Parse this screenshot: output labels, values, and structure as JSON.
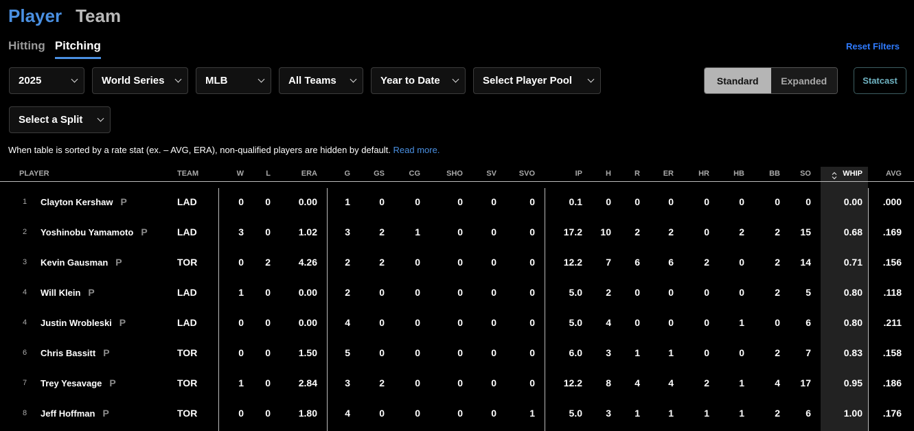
{
  "header": {
    "tabs": [
      "Player",
      "Team"
    ],
    "sub_tabs": [
      "Hitting",
      "Pitching"
    ],
    "reset_label": "Reset Filters"
  },
  "filters": {
    "season": "2025",
    "game_type": "World Series",
    "league": "MLB",
    "team": "All Teams",
    "period": "Year to Date",
    "player_pool": "Select Player Pool",
    "split": "Select a Split"
  },
  "view_toggle": {
    "standard": "Standard",
    "expanded": "Expanded"
  },
  "statcast_label": "Statcast",
  "note": {
    "text": "When table is sorted by a rate stat (ex. – AVG, ERA), non-qualified players are hidden by default.",
    "link": "Read more."
  },
  "table": {
    "columns": [
      "PLAYER",
      "TEAM",
      "W",
      "L",
      "ERA",
      "G",
      "GS",
      "CG",
      "SHO",
      "SV",
      "SVO",
      "IP",
      "H",
      "R",
      "ER",
      "HR",
      "HB",
      "BB",
      "SO",
      "WHIP",
      "AVG"
    ],
    "rows": [
      {
        "rank": "1",
        "name": "Clayton Kershaw",
        "pos": "P",
        "team": "LAD",
        "w": "0",
        "l": "0",
        "era": "0.00",
        "g": "1",
        "gs": "0",
        "cg": "0",
        "sho": "0",
        "sv": "0",
        "svo": "0",
        "ip": "0.1",
        "h": "0",
        "r": "0",
        "er": "0",
        "hr": "0",
        "hb": "0",
        "bb": "0",
        "so": "0",
        "whip": "0.00",
        "avg": ".000"
      },
      {
        "rank": "2",
        "name": "Yoshinobu Yamamoto",
        "pos": "P",
        "team": "LAD",
        "w": "3",
        "l": "0",
        "era": "1.02",
        "g": "3",
        "gs": "2",
        "cg": "1",
        "sho": "0",
        "sv": "0",
        "svo": "0",
        "ip": "17.2",
        "h": "10",
        "r": "2",
        "er": "2",
        "hr": "0",
        "hb": "2",
        "bb": "2",
        "so": "15",
        "whip": "0.68",
        "avg": ".169"
      },
      {
        "rank": "3",
        "name": "Kevin Gausman",
        "pos": "P",
        "team": "TOR",
        "w": "0",
        "l": "2",
        "era": "4.26",
        "g": "2",
        "gs": "2",
        "cg": "0",
        "sho": "0",
        "sv": "0",
        "svo": "0",
        "ip": "12.2",
        "h": "7",
        "r": "6",
        "er": "6",
        "hr": "2",
        "hb": "0",
        "bb": "2",
        "so": "14",
        "whip": "0.71",
        "avg": ".156"
      },
      {
        "rank": "4",
        "name": "Will Klein",
        "pos": "P",
        "team": "LAD",
        "w": "1",
        "l": "0",
        "era": "0.00",
        "g": "2",
        "gs": "0",
        "cg": "0",
        "sho": "0",
        "sv": "0",
        "svo": "0",
        "ip": "5.0",
        "h": "2",
        "r": "0",
        "er": "0",
        "hr": "0",
        "hb": "0",
        "bb": "2",
        "so": "5",
        "whip": "0.80",
        "avg": ".118"
      },
      {
        "rank": "4",
        "name": "Justin Wrobleski",
        "pos": "P",
        "team": "LAD",
        "w": "0",
        "l": "0",
        "era": "0.00",
        "g": "4",
        "gs": "0",
        "cg": "0",
        "sho": "0",
        "sv": "0",
        "svo": "0",
        "ip": "5.0",
        "h": "4",
        "r": "0",
        "er": "0",
        "hr": "0",
        "hb": "1",
        "bb": "0",
        "so": "6",
        "whip": "0.80",
        "avg": ".211"
      },
      {
        "rank": "6",
        "name": "Chris Bassitt",
        "pos": "P",
        "team": "TOR",
        "w": "0",
        "l": "0",
        "era": "1.50",
        "g": "5",
        "gs": "0",
        "cg": "0",
        "sho": "0",
        "sv": "0",
        "svo": "0",
        "ip": "6.0",
        "h": "3",
        "r": "1",
        "er": "1",
        "hr": "0",
        "hb": "0",
        "bb": "2",
        "so": "7",
        "whip": "0.83",
        "avg": ".158"
      },
      {
        "rank": "7",
        "name": "Trey Yesavage",
        "pos": "P",
        "team": "TOR",
        "w": "1",
        "l": "0",
        "era": "2.84",
        "g": "3",
        "gs": "2",
        "cg": "0",
        "sho": "0",
        "sv": "0",
        "svo": "0",
        "ip": "12.2",
        "h": "8",
        "r": "4",
        "er": "4",
        "hr": "2",
        "hb": "1",
        "bb": "4",
        "so": "17",
        "whip": "0.95",
        "avg": ".186"
      },
      {
        "rank": "8",
        "name": "Jeff Hoffman",
        "pos": "P",
        "team": "TOR",
        "w": "0",
        "l": "0",
        "era": "1.80",
        "g": "4",
        "gs": "0",
        "cg": "0",
        "sho": "0",
        "sv": "0",
        "svo": "1",
        "ip": "5.0",
        "h": "3",
        "r": "1",
        "er": "1",
        "hr": "1",
        "hb": "1",
        "bb": "2",
        "so": "6",
        "whip": "1.00",
        "avg": ".176"
      }
    ]
  },
  "colors": {
    "accent": "#4a90e2",
    "link": "#2f7bff",
    "statcast": "#6fb3c2",
    "sorted_column_bg": "#222222"
  }
}
